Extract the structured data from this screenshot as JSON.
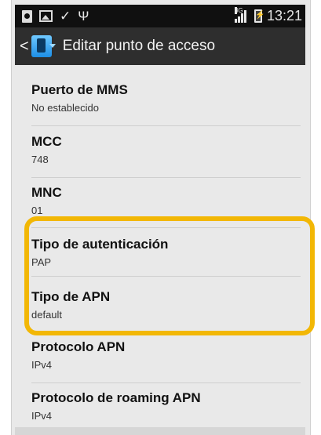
{
  "status_bar": {
    "icons": [
      "file-icon",
      "image-icon",
      "check-icon",
      "usb-icon",
      "signal-3g-icon",
      "battery-charging-icon"
    ],
    "time": "13:21"
  },
  "action_bar": {
    "back_glyph": "<",
    "title": "Editar punto de acceso"
  },
  "settings": [
    {
      "label": "Puerto de MMS",
      "value": "No establecido"
    },
    {
      "label": "MCC",
      "value": "748"
    },
    {
      "label": "MNC",
      "value": "01"
    },
    {
      "label": "Tipo de autenticación",
      "value": "PAP"
    },
    {
      "label": "Tipo de APN",
      "value": "default"
    },
    {
      "label": "Protocolo APN",
      "value": "IPv4"
    },
    {
      "label": "Protocolo de roaming APN",
      "value": "IPv4"
    }
  ],
  "colors": {
    "highlight": "#f2b705",
    "action_bar": "#2e2e2e",
    "status_bar": "#101010",
    "list_background": "#e9e9e9"
  }
}
